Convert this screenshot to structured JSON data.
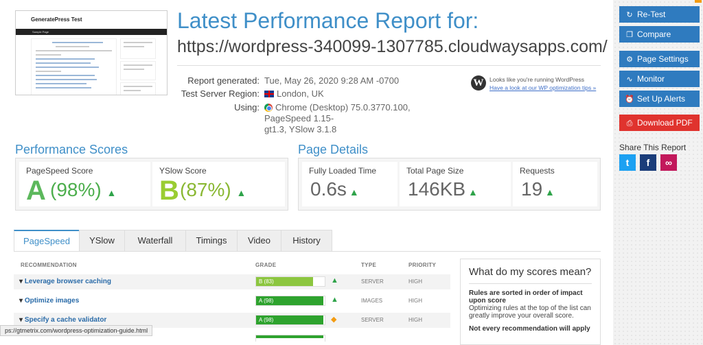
{
  "header": {
    "title": "Latest Performance Report for:",
    "url": "https://wordpress-340099-1307785.cloudwaysapps.com/"
  },
  "thumbnail": {
    "site_title": "GeneratePress Test",
    "nav_text": "Sample Page"
  },
  "meta": {
    "report_generated_label": "Report generated:",
    "report_generated_value": "Tue, May 26, 2020 9:28 AM -0700",
    "region_label": "Test Server Region:",
    "region_value": "London, UK",
    "using_label": "Using:",
    "using_value_line1": "Chrome (Desktop) 75.0.3770.100, PageSpeed 1.15-",
    "using_value_line2": "gt1.3, YSlow 3.1.8"
  },
  "wordpress": {
    "line1": "Looks like you're running WordPress",
    "link": "Have a look at our WP optimization tips »"
  },
  "performance_scores": {
    "title": "Performance Scores",
    "pagespeed_label": "PageSpeed Score",
    "pagespeed_grade": "A",
    "pagespeed_pct": "(98%)",
    "yslow_label": "YSlow Score",
    "yslow_grade": "B",
    "yslow_pct": "(87%)"
  },
  "page_details": {
    "title": "Page Details",
    "loaded_label": "Fully Loaded Time",
    "loaded_value": "0.6s",
    "size_label": "Total Page Size",
    "size_value": "146KB",
    "requests_label": "Requests",
    "requests_value": "19"
  },
  "tabs": [
    "PageSpeed",
    "YSlow",
    "Waterfall",
    "Timings",
    "Video",
    "History"
  ],
  "table": {
    "headers": {
      "recommendation": "RECOMMENDATION",
      "grade": "GRADE",
      "type": "TYPE",
      "priority": "PRIORITY"
    },
    "rows": [
      {
        "name": "Leverage browser caching",
        "grade": "B (83)",
        "score": 83,
        "type": "SERVER",
        "priority": "HIGH",
        "color": "#8cc63f",
        "indicator": "up"
      },
      {
        "name": "Optimize images",
        "grade": "A (98)",
        "score": 98,
        "type": "IMAGES",
        "priority": "HIGH",
        "color": "#2ea32e",
        "indicator": "up"
      },
      {
        "name": "Specify a cache validator",
        "grade": "A (98)",
        "score": 98,
        "type": "SERVER",
        "priority": "HIGH",
        "color": "#2ea32e",
        "indicator": "diamond"
      }
    ]
  },
  "explain": {
    "title": "What do my scores mean?",
    "bold1": "Rules are sorted in order of impact upon score",
    "text1": "Optimizing rules at the top of the list can greatly improve your overall score.",
    "bold2": "Not every recommendation will apply"
  },
  "status_bar": {
    "url": "https://gtmetrix.com/wordpress-optimization-guide.html",
    "shown": "ps://gtmetrix.com/wordpress-optimization-guide.html"
  },
  "sidebar": {
    "retest": "Re-Test",
    "compare": "Compare",
    "page_settings": "Page Settings",
    "monitor": "Monitor",
    "alerts": "Set Up Alerts",
    "pdf": "Download PDF",
    "share_label": "Share This Report"
  },
  "colors": {
    "accent": "#3f8fc8",
    "button": "#2f7bbf",
    "pdf": "#e0332e",
    "grade_green": "#5cb85c"
  }
}
